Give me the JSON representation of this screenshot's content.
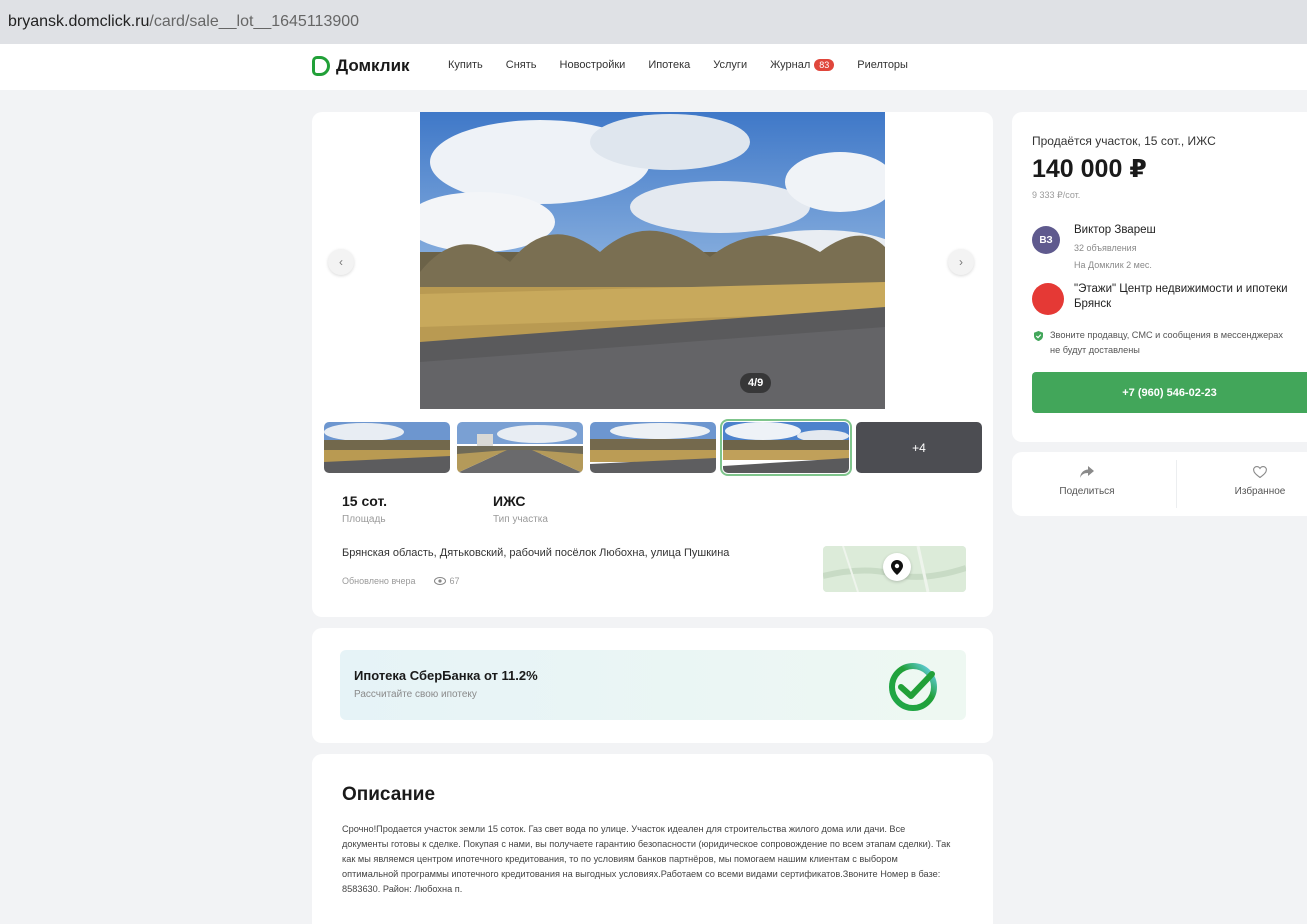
{
  "browser": {
    "url_host": "bryansk.domclick.ru",
    "url_path": "/card/sale__lot__1645113900"
  },
  "header": {
    "logo": "Домклик",
    "nav": [
      {
        "label": "Купить"
      },
      {
        "label": "Снять"
      },
      {
        "label": "Новостройки"
      },
      {
        "label": "Ипотека"
      },
      {
        "label": "Услуги"
      },
      {
        "label": "Журнал",
        "badge": "83"
      },
      {
        "label": "Риелторы"
      }
    ]
  },
  "gallery": {
    "counter": "4/9",
    "more": "+4"
  },
  "facts": {
    "area_value": "15 сот.",
    "area_label": "Площадь",
    "type_value": "ИЖС",
    "type_label": "Тип участка"
  },
  "location": {
    "address": "Брянская область, Дятьковский, рабочий посёлок Любохна, улица Пушкина",
    "updated": "Обновлено вчера",
    "views": "67"
  },
  "mortgage": {
    "title": "Ипотека СберБанка от 11.2%",
    "subtitle": "Рассчитайте свою ипотеку"
  },
  "description": {
    "title": "Описание",
    "text": "Срочно!Продается участок земли 15 соток. Газ свет вода по улице. Участок идеален для строительства жилого дома или дачи. Все документы готовы к сделке. Покупая с нами, вы получаете гарантию безопасности (юридическое сопровождение по всем этапам сделки). Так как мы являемся центром ипотечного кредитования, то по условиям банков партнёров, мы помогаем нашим клиентам с выбором оптимальной программы ипотечного кредитования на выгодных условиях.Работаем со всеми видами сертификатов.Звоните Номер в базе: 8583630. Район: Любохна п."
  },
  "offer": {
    "title": "Продаётся участок, 15 сот., ИЖС",
    "price": "140 000 ₽",
    "price_per": "9 333 ₽/сот.",
    "seller_initials": "ВЗ",
    "seller_name": "Виктор Звареш",
    "seller_ads": "32 объявления",
    "seller_since": "На Домклик 2 мес.",
    "agency": "\"Этажи\" Центр недвижимости и ипотеки Брянск",
    "notice": "Звоните продавцу, СМС и сообщения в мессенджерах не будут доставлены",
    "phone": "+7 (960) 546-02-23"
  },
  "actions": {
    "share": "Поделиться",
    "favorite": "Избранное"
  },
  "colors": {
    "brand_green": "#21a038",
    "call_button": "#42a65a",
    "seller_avatar": "#5f5a8e",
    "agency_red": "#e53935",
    "badge_red": "#e0463b"
  }
}
